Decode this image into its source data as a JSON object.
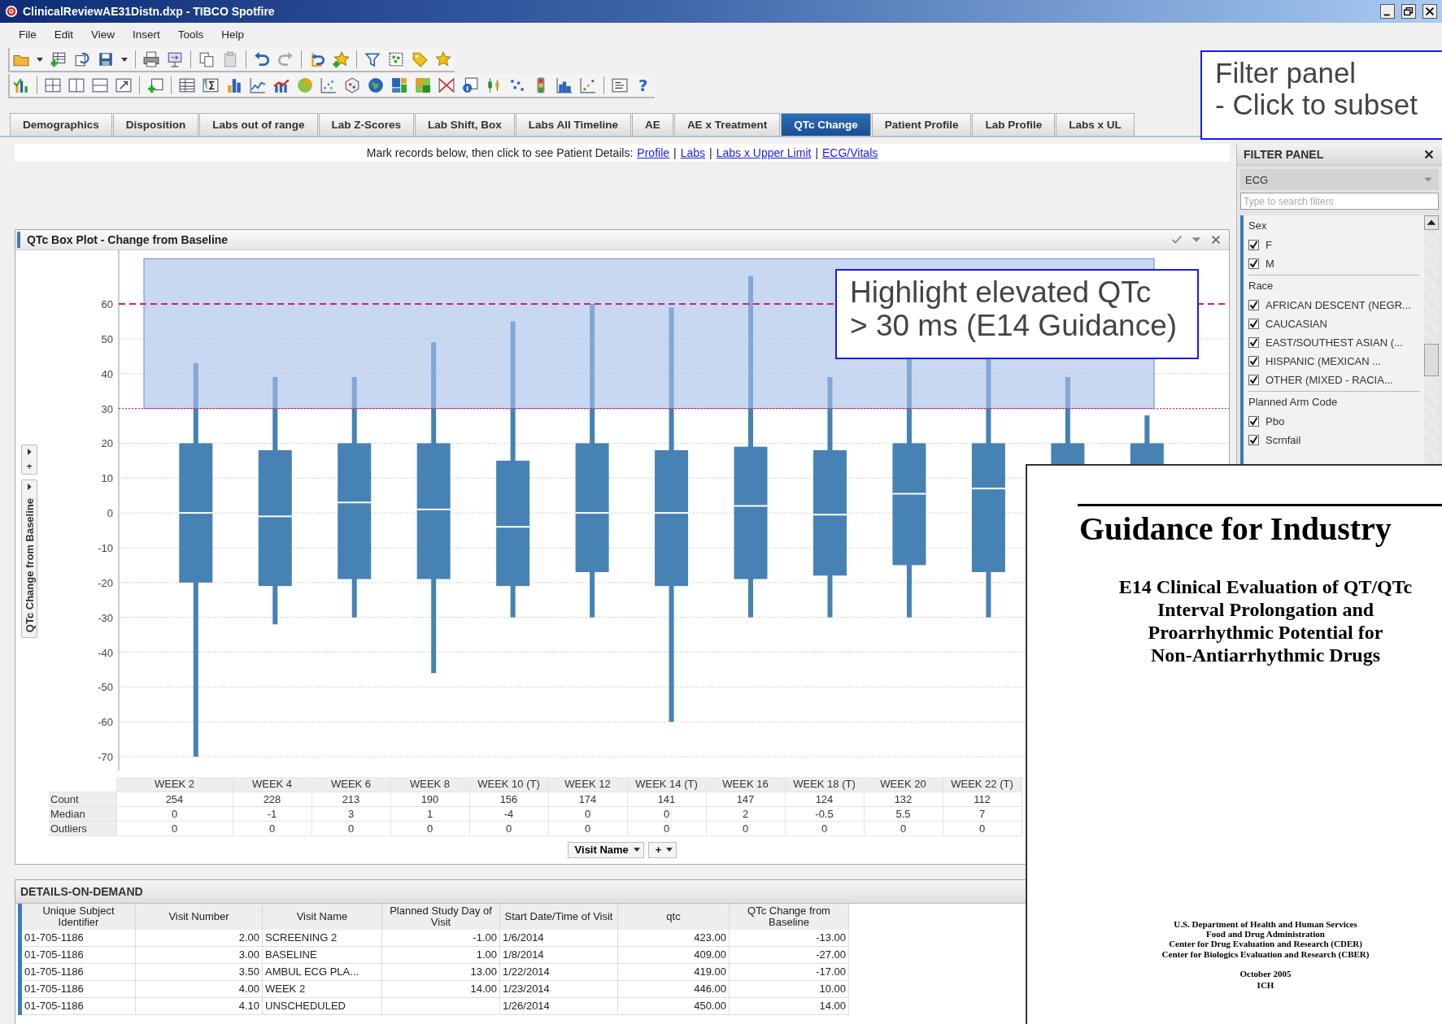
{
  "window": {
    "title": "ClinicalReviewAE31Distn.dxp - TIBCO Spotfire"
  },
  "menu": [
    "File",
    "Edit",
    "View",
    "Insert",
    "Tools",
    "Help"
  ],
  "toolbar": {
    "help_label": "?"
  },
  "tabs": [
    {
      "label": "Demographics",
      "selected": false
    },
    {
      "label": "Disposition",
      "selected": false
    },
    {
      "label": "Labs out of range",
      "selected": false
    },
    {
      "label": "Lab Z-Scores",
      "selected": false
    },
    {
      "label": "Lab Shift, Box",
      "selected": false
    },
    {
      "label": "Labs All Timeline",
      "selected": false
    },
    {
      "label": "AE",
      "selected": false
    },
    {
      "label": "AE x Treatment",
      "selected": false
    },
    {
      "label": "QTc Change",
      "selected": true
    },
    {
      "label": "Patient Profile",
      "selected": false
    },
    {
      "label": "Lab Profile",
      "selected": false
    },
    {
      "label": "Labs x UL",
      "selected": false
    }
  ],
  "instruction": {
    "text": "Mark records below, then click to see Patient Details:",
    "links": [
      "Profile",
      "Labs",
      "Labs x Upper Limit",
      "ECG/Vitals"
    ],
    "separators": [
      "|",
      "|",
      "|"
    ]
  },
  "box_plot": {
    "title": "QTc Box Plot - Change from Baseline",
    "axis_title": "QTc Change from Baseline",
    "axis_add_label": "+",
    "y_ticks": [
      "60",
      "50",
      "40",
      "30",
      "20",
      "10",
      "0",
      "-10",
      "-20",
      "-30",
      "-40",
      "-50",
      "-60",
      "-70"
    ],
    "stats": {
      "columns": [
        "WEEK 2",
        "WEEK 4",
        "WEEK 6",
        "WEEK 8",
        "WEEK 10 (T)",
        "WEEK 12",
        "WEEK 14 (T)",
        "WEEK 16",
        "WEEK 18 (T)",
        "WEEK 20",
        "WEEK 22 (T)"
      ],
      "rows": [
        {
          "label": "Count",
          "values": [
            "254",
            "228",
            "213",
            "190",
            "156",
            "174",
            "141",
            "147",
            "124",
            "132",
            "112"
          ]
        },
        {
          "label": "Median",
          "values": [
            "0",
            "-1",
            "3",
            "1",
            "-4",
            "0",
            "0",
            "2",
            "-0.5",
            "5.5",
            "7"
          ]
        },
        {
          "label": "Outliers",
          "values": [
            "0",
            "0",
            "0",
            "0",
            "0",
            "0",
            "0",
            "0",
            "0",
            "0",
            "0"
          ]
        }
      ]
    },
    "x_selector": "Visit Name",
    "add_selector": "+"
  },
  "details": {
    "title": "DETAILS-ON-DEMAND",
    "columns": [
      "Unique Subject Identifier",
      "Visit Number",
      "Visit Name",
      "Planned Study Day of Visit",
      "Start Date/Time of Visit",
      "qtc",
      "QTc Change from Baseline"
    ],
    "rows": [
      [
        "01-705-1186",
        "2.00",
        "SCREENING 2",
        "-1.00",
        "1/6/2014",
        "423.00",
        "-13.00"
      ],
      [
        "01-705-1186",
        "3.00",
        "BASELINE",
        "1.00",
        "1/8/2014",
        "409.00",
        "-27.00"
      ],
      [
        "01-705-1186",
        "3.50",
        "AMBUL ECG PLA...",
        "13.00",
        "1/22/2014",
        "419.00",
        "-17.00"
      ],
      [
        "01-705-1186",
        "4.00",
        "WEEK 2",
        "14.00",
        "1/23/2014",
        "446.00",
        "10.00"
      ],
      [
        "01-705-1186",
        "4.10",
        "UNSCHEDULED",
        null,
        "1/26/2014",
        "450.00",
        "14.00"
      ]
    ]
  },
  "filter_panel": {
    "title": "FILTER PANEL",
    "group": "ECG",
    "search_placeholder": "Type to search filters",
    "sections": [
      {
        "title": "Sex",
        "items": [
          {
            "label": "F",
            "checked": true
          },
          {
            "label": "M",
            "checked": true
          }
        ]
      },
      {
        "title": "Race",
        "items": [
          {
            "label": "AFRICAN DESCENT (NEGR...",
            "checked": true
          },
          {
            "label": "CAUCASIAN",
            "checked": true
          },
          {
            "label": "EAST/SOUTHEST ASIAN (...",
            "checked": true
          },
          {
            "label": "HISPANIC (MEXICAN ...",
            "checked": true
          },
          {
            "label": "OTHER (MIXED - RACIA...",
            "checked": true
          }
        ]
      },
      {
        "title": "Planned Arm Code",
        "items": [
          {
            "label": "Pbo",
            "checked": true
          },
          {
            "label": "Scrnfail",
            "checked": true
          }
        ]
      }
    ]
  },
  "callouts": [
    {
      "kind": "filter_note",
      "text": "Filter panel\n- Click to subset"
    },
    {
      "kind": "chart_note",
      "text": "Highlight elevated QTc\n> 30 ms (E14 Guidance)"
    }
  ],
  "document": {
    "title": "Guidance for Industry",
    "subtitle": "E14 Clinical Evaluation of QT/QTc\nInterval Prolongation and\nProarrhythmic Potential for\nNon-Antiarrhythmic Drugs",
    "agencies": "U.S. Department of Health and Human Services\nFood and Drug Administration\nCenter for Drug Evaluation and Research (CDER)\nCenter for Biologics Evaluation and Research (CBER)",
    "date": "October 2005",
    "org": "ICH"
  }
}
